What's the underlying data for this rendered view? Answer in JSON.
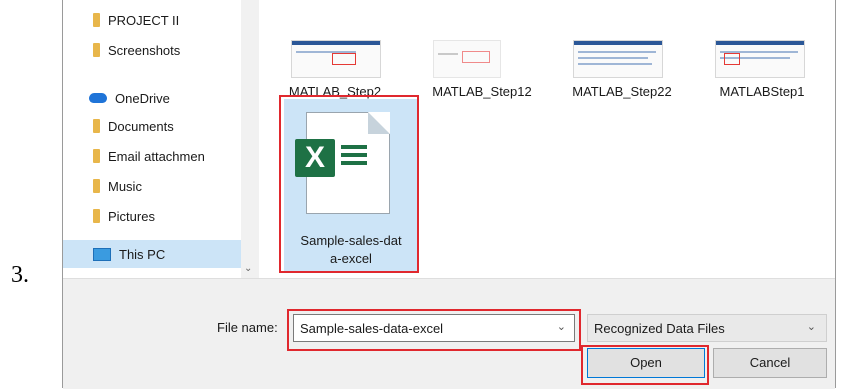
{
  "step_number": "3.",
  "nav": {
    "items": [
      {
        "label": "PROJECT II",
        "icon": "folder-icon"
      },
      {
        "label": "Screenshots",
        "icon": "folder-icon"
      },
      {
        "label": "OneDrive",
        "icon": "onedrive-cloud-icon"
      },
      {
        "label": "Documents",
        "icon": "folder-icon"
      },
      {
        "label": "Email attachmen",
        "icon": "folder-icon"
      },
      {
        "label": "Music",
        "icon": "folder-icon"
      },
      {
        "label": "Pictures",
        "icon": "folder-icon"
      },
      {
        "label": "This PC",
        "icon": "computer-icon",
        "selected": true
      }
    ]
  },
  "files": [
    {
      "name": "MATLAB_Step2"
    },
    {
      "name": "MATLAB_Step12"
    },
    {
      "name": "MATLAB_Step22"
    },
    {
      "name": "MATLABStep1"
    },
    {
      "name_line1": "Sample-sales-dat",
      "name_line2": "a-excel",
      "selected": true,
      "icon": "excel-file-icon",
      "logo_letter": "X"
    }
  ],
  "bottom": {
    "file_name_label": "File name:",
    "file_name_value": "Sample-sales-data-excel",
    "file_type_value": "Recognized Data Files",
    "open_label": "Open",
    "cancel_label": "Cancel"
  },
  "colors": {
    "highlight_red": "#e0282e",
    "selection_blue": "#cce4f7",
    "excel_green": "#1e7145"
  }
}
